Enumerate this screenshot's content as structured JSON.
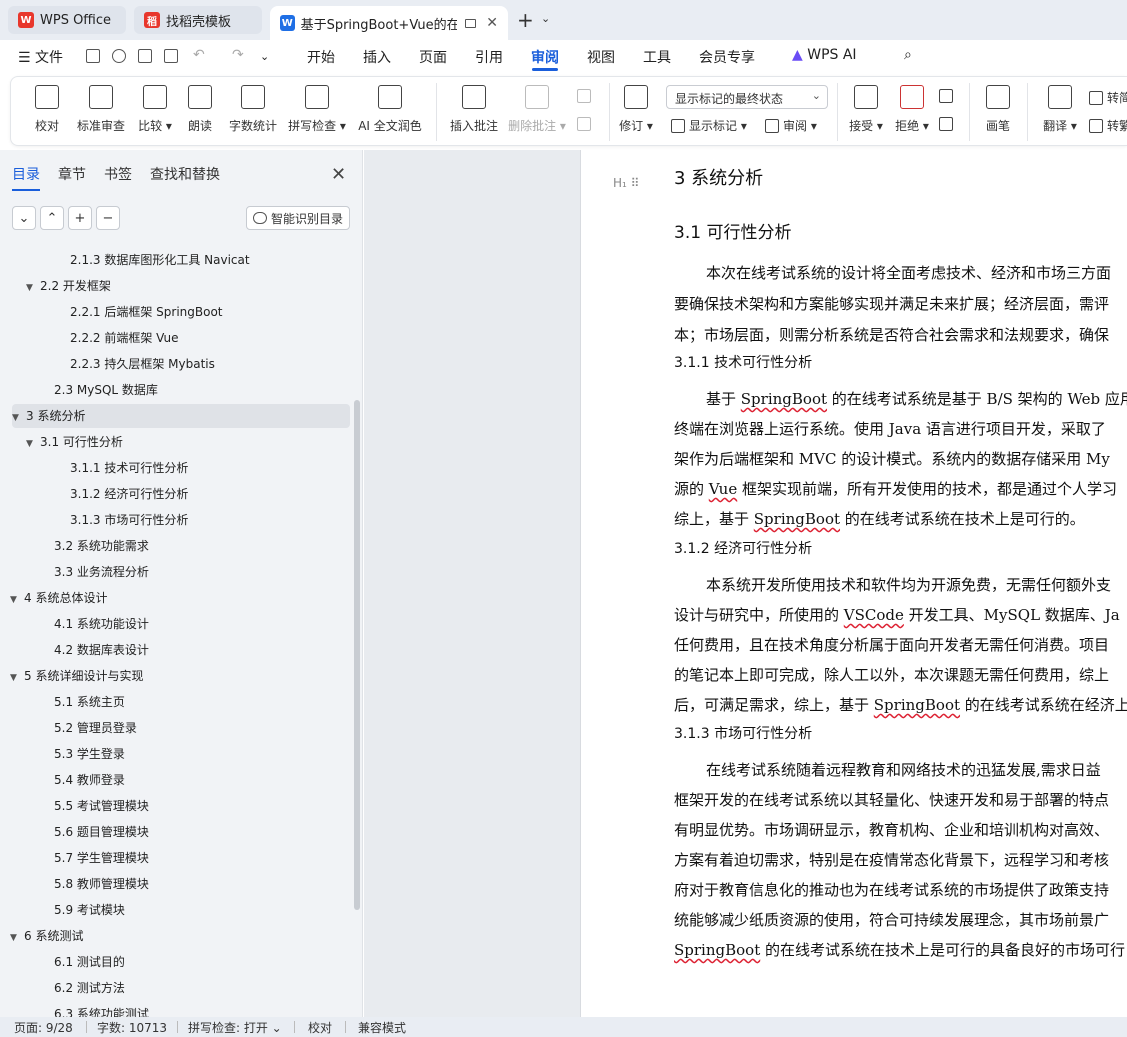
{
  "tabs": [
    {
      "label": "WPS Office",
      "icon_color": "#e8372c",
      "icon": "wps-logo-icon"
    },
    {
      "label": "找稻壳模板",
      "icon_color": "#e8372c",
      "icon": "daoke-icon"
    },
    {
      "label": "基于SpringBoot+Vue的在线",
      "icon_color": "#1f6fe5",
      "icon": "word-doc-icon"
    }
  ],
  "menubar": {
    "file": "文件",
    "items": [
      "开始",
      "插入",
      "页面",
      "引用",
      "审阅",
      "视图",
      "工具",
      "会员专享"
    ],
    "active": "审阅",
    "wps_ai": "WPS AI"
  },
  "ribbon": {
    "proofread": "校对",
    "standard_review": "标准审查",
    "compare": "比较",
    "read_aloud": "朗读",
    "word_count": "字数统计",
    "spell_check": "拼写检查",
    "ai_polish": "AI 全文润色",
    "insert_comment": "插入批注",
    "delete_comment": "删除批注",
    "track_changes": "修订",
    "display_mode": "显示标记的最终状态",
    "show_markup": "显示标记",
    "review": "审阅",
    "accept": "接受",
    "reject": "拒绝",
    "pen": "画笔",
    "translate": "翻译",
    "convert_simplified": "转简",
    "convert_traditional": "转繁"
  },
  "sidebar": {
    "tabs": [
      "目录",
      "章节",
      "书签",
      "查找和替换"
    ],
    "smart_toc": "智能识别目录",
    "toc": [
      {
        "label": "2.1.3  数据库图形化工具 Navicat",
        "level": 3
      },
      {
        "label": "2.2  开发框架",
        "level": 2,
        "expanded": true
      },
      {
        "label": "2.2.1  后端框架 SpringBoot",
        "level": 3
      },
      {
        "label": "2.2.2  前端框架 Vue",
        "level": 3
      },
      {
        "label": "2.2.3  持久层框架 Mybatis",
        "level": 3
      },
      {
        "label": "2.3 MySQL 数据库",
        "level": 2
      },
      {
        "label": "3  系统分析",
        "level": 1,
        "expanded": true,
        "selected": true
      },
      {
        "label": "3.1  可行性分析",
        "level": 2,
        "expanded": true
      },
      {
        "label": "3.1.1  技术可行性分析",
        "level": 3
      },
      {
        "label": "3.1.2  经济可行性分析",
        "level": 3
      },
      {
        "label": "3.1.3  市场可行性分析",
        "level": 3
      },
      {
        "label": "3.2  系统功能需求",
        "level": 2
      },
      {
        "label": "3.3  业务流程分析",
        "level": 2
      },
      {
        "label": "4  系统总体设计",
        "level": 1,
        "expanded": true
      },
      {
        "label": "4.1  系统功能设计",
        "level": 2
      },
      {
        "label": "4.2  数据库表设计",
        "level": 2
      },
      {
        "label": "5  系统详细设计与实现",
        "level": 1,
        "expanded": true
      },
      {
        "label": "5.1  系统主页",
        "level": 2
      },
      {
        "label": "5.2  管理员登录",
        "level": 2
      },
      {
        "label": "5.3  学生登录",
        "level": 2
      },
      {
        "label": "5.4  教师登录",
        "level": 2
      },
      {
        "label": "5.5  考试管理模块",
        "level": 2
      },
      {
        "label": "5.6  题目管理模块",
        "level": 2
      },
      {
        "label": "5.7  学生管理模块",
        "level": 2
      },
      {
        "label": "5.8  教师管理模块",
        "level": 2
      },
      {
        "label": "5.9  考试模块",
        "level": 2
      },
      {
        "label": "6  系统测试",
        "level": 1,
        "expanded": true
      },
      {
        "label": "6.1  测试目的",
        "level": 2
      },
      {
        "label": "6.2  测试方法",
        "level": 2
      },
      {
        "label": "6.3  系统功能测试",
        "level": 2
      }
    ]
  },
  "document": {
    "h1": "3  系统分析",
    "h2": "3.1  可行性分析",
    "para1": [
      "本次在线考试系统的设计将全面考虑技术、经济和市场三方面",
      "要确保技术架构和方案能够实现并满足未来扩展；经济层面，需评",
      "本；市场层面，则需分析系统是否符合社会需求和法规要求，确保"
    ],
    "h3_1": "3.1.1  技术可行性分析",
    "para2": [
      [
        "基于 ",
        "SpringBoot",
        " 的在线考试系统是基于 B/S 架构的 Web 应用"
      ],
      [
        "终端在浏览器上运行系统。使用 Java 语言进行项目开发，采取了"
      ],
      [
        "架作为后端框架和 MVC 的设计模式。系统内的数据存储采用 My"
      ],
      [
        "源的 ",
        "Vue",
        " 框架实现前端，所有开发使用的技术，都是通过个人学习"
      ],
      [
        "综上，基于 ",
        "SpringBoot",
        " 的在线考试系统在技术上是可行的。"
      ]
    ],
    "h3_2": "3.1.2  经济可行性分析",
    "para3": [
      [
        "本系统开发所使用技术和软件均为开源免费，无需任何额外支"
      ],
      [
        "设计与研究中，所使用的 ",
        "VSCode",
        " 开发工具、MySQL 数据库、Ja"
      ],
      [
        "任何费用，且在技术角度分析属于面向开发者无需任何消费。项目"
      ],
      [
        "的笔记本上即可完成，除人工以外，本次课题无需任何费用，综上"
      ],
      [
        "后，可满足需求，综上，基于 ",
        "SpringBoot",
        " 的在线考试系统在经济上"
      ]
    ],
    "h3_3": "3.1.3  市场可行性分析",
    "para4": [
      [
        "在线考试系统随着远程教育和网络技术的迅猛发展,需求日益"
      ],
      [
        "框架开发的在线考试系统以其轻量化、快速开发和易于部署的特点"
      ],
      [
        "有明显优势。市场调研显示，教育机构、企业和培训机构对高效、"
      ],
      [
        "方案有着迫切需求，特别是在疫情常态化背景下，远程学习和考核"
      ],
      [
        "府对于教育信息化的推动也为在线考试系统的市场提供了政策支持"
      ],
      [
        "统能够减少纸质资源的使用，符合可持续发展理念，其市场前景广"
      ],
      [
        "",
        "SpringBoot",
        " 的在线考试系统在技术上是可行的具备良好的市场可行"
      ]
    ]
  },
  "statusbar": {
    "page": "页面: 9/28",
    "words": "字数: 10713",
    "spell": "拼写检查: 打开",
    "proof": "校对",
    "compat": "兼容模式"
  },
  "colors": {
    "accent": "#1a5edb",
    "wavy": "#d23"
  }
}
